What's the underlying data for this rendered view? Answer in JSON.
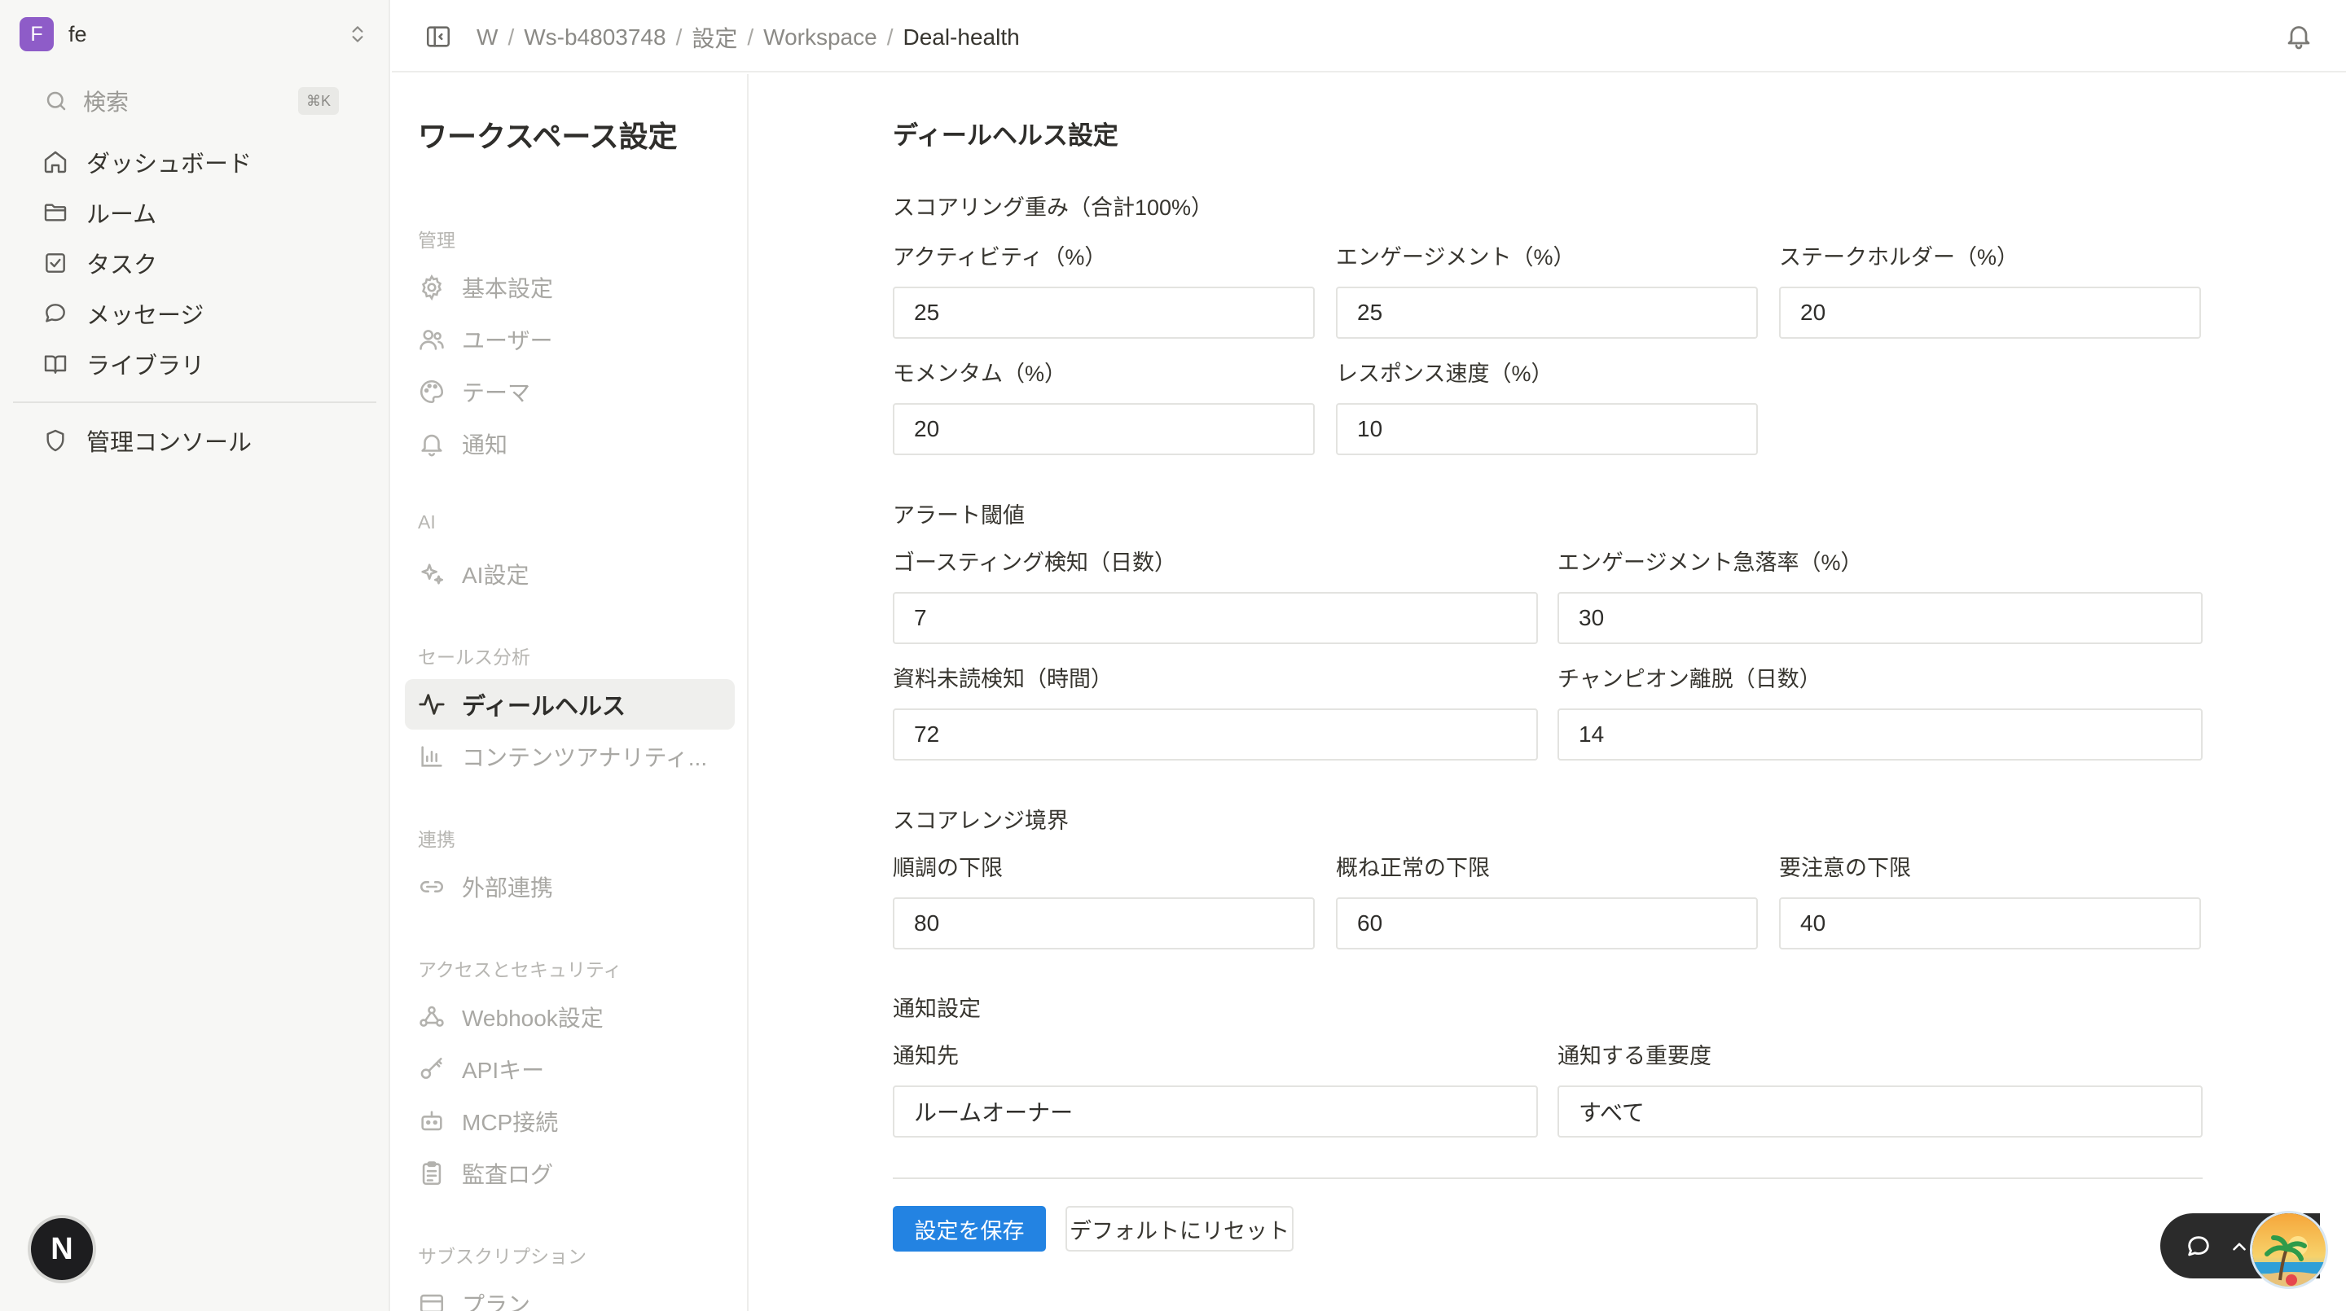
{
  "colors": {
    "accent": "#2383e2",
    "workspace_avatar": "#8e5cc8",
    "sidebar_bg": "#f7f7f5"
  },
  "workspace": {
    "initial": "F",
    "name": "fe"
  },
  "search": {
    "label": "検索",
    "shortcut": "⌘K"
  },
  "sidebar": {
    "items": [
      {
        "label": "ダッシュボード",
        "icon": "home-icon"
      },
      {
        "label": "ルーム",
        "icon": "folder-icon"
      },
      {
        "label": "タスク",
        "icon": "checkbox-icon"
      },
      {
        "label": "メッセージ",
        "icon": "chat-bubble-icon"
      },
      {
        "label": "ライブラリ",
        "icon": "book-icon"
      }
    ],
    "admin": {
      "label": "管理コンソール",
      "icon": "shield-icon"
    }
  },
  "bottom_badge": {
    "label": "N"
  },
  "breadcrumb": [
    "W",
    "Ws-b4803748",
    "設定",
    "Workspace",
    "Deal-health"
  ],
  "settings_nav": {
    "title": "ワークスペース設定",
    "groups": [
      {
        "label": "管理",
        "items": [
          {
            "label": "基本設定",
            "icon": "gear-icon"
          },
          {
            "label": "ユーザー",
            "icon": "users-icon"
          },
          {
            "label": "テーマ",
            "icon": "palette-icon"
          },
          {
            "label": "通知",
            "icon": "bell-icon"
          }
        ]
      },
      {
        "label": "AI",
        "items": [
          {
            "label": "AI設定",
            "icon": "sparkles-icon"
          }
        ]
      },
      {
        "label": "セールス分析",
        "items": [
          {
            "label": "ディールヘルス",
            "icon": "activity-icon",
            "active": true
          },
          {
            "label": "コンテンツアナリティ...",
            "icon": "bar-chart-icon"
          }
        ]
      },
      {
        "label": "連携",
        "items": [
          {
            "label": "外部連携",
            "icon": "link-icon"
          }
        ]
      },
      {
        "label": "アクセスとセキュリティ",
        "items": [
          {
            "label": "Webhook設定",
            "icon": "webhook-icon"
          },
          {
            "label": "APIキー",
            "icon": "key-icon"
          },
          {
            "label": "MCP接続",
            "icon": "bot-icon"
          },
          {
            "label": "監査ログ",
            "icon": "clipboard-icon"
          }
        ]
      },
      {
        "label": "サブスクリプション",
        "items": [
          {
            "label": "プラン",
            "icon": "card-icon"
          }
        ]
      }
    ]
  },
  "main": {
    "title": "ディールヘルス設定",
    "weights": {
      "title": "スコアリング重み（合計100%）",
      "activity": {
        "label": "アクティビティ（%）",
        "value": "25"
      },
      "engagement": {
        "label": "エンゲージメント（%）",
        "value": "25"
      },
      "stakeholder": {
        "label": "ステークホルダー（%）",
        "value": "20"
      },
      "momentum": {
        "label": "モメンタム（%）",
        "value": "20"
      },
      "response": {
        "label": "レスポンス速度（%）",
        "value": "10"
      }
    },
    "alerts": {
      "title": "アラート閾値",
      "ghosting": {
        "label": "ゴースティング検知（日数）",
        "value": "7"
      },
      "engagement_drop": {
        "label": "エンゲージメント急落率（%）",
        "value": "30"
      },
      "unread": {
        "label": "資料未読検知（時間）",
        "value": "72"
      },
      "champion": {
        "label": "チャンピオン離脱（日数）",
        "value": "14"
      }
    },
    "ranges": {
      "title": "スコアレンジ境界",
      "good": {
        "label": "順調の下限",
        "value": "80"
      },
      "normal": {
        "label": "概ね正常の下限",
        "value": "60"
      },
      "caution": {
        "label": "要注意の下限",
        "value": "40"
      }
    },
    "notify": {
      "title": "通知設定",
      "target": {
        "label": "通知先",
        "value": "ルームオーナー"
      },
      "severity": {
        "label": "通知する重要度",
        "value": "すべて"
      }
    },
    "save_label": "設定を保存",
    "reset_label": "デフォルトにリセット"
  }
}
